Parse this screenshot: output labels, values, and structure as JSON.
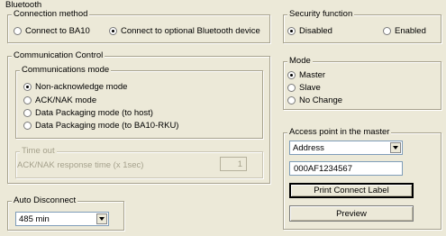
{
  "bluetooth_title": "Bluetooth",
  "connection_method": {
    "legend": "Connection method",
    "options": [
      {
        "label": "Connect to BA10",
        "selected": false
      },
      {
        "label": "Connect to optional Bluetooth device",
        "selected": true
      }
    ]
  },
  "security_function": {
    "legend": "Security function",
    "options": [
      {
        "label": "Disabled",
        "selected": true
      },
      {
        "label": "Enabled",
        "selected": false
      }
    ]
  },
  "communication_control": {
    "legend": "Communication Control",
    "communications_mode": {
      "legend": "Communications mode",
      "options": [
        {
          "label": "Non-acknowledge mode",
          "selected": true
        },
        {
          "label": "ACK/NAK mode",
          "selected": false
        },
        {
          "label": "Data Packaging mode (to host)",
          "selected": false
        },
        {
          "label": "Data Packaging mode (to BA10-RKU)",
          "selected": false
        }
      ]
    },
    "time_out": {
      "legend": "Time out",
      "response_label": "ACK/NAK response time (x 1sec)",
      "value": "1"
    }
  },
  "mode": {
    "legend": "Mode",
    "options": [
      {
        "label": "Master",
        "selected": true
      },
      {
        "label": "Slave",
        "selected": false
      },
      {
        "label": "No Change",
        "selected": false
      }
    ]
  },
  "access_point": {
    "legend": "Access point in the master",
    "select_value": "Address",
    "address_value": "000AF1234567",
    "print_button": "Print Connect Label",
    "preview_button": "Preview"
  },
  "auto_disconnect": {
    "legend": "Auto Disconnect",
    "value": "485 min"
  }
}
